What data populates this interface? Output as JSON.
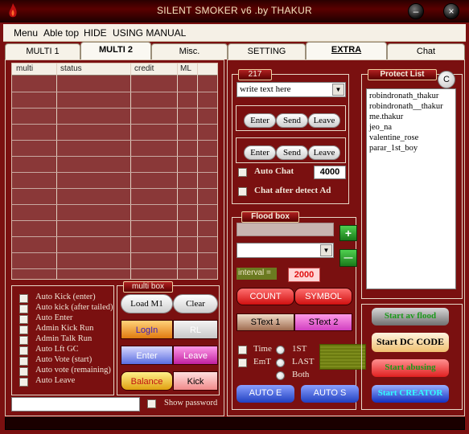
{
  "window": {
    "title": "SILENT SMOKER v6  .by THAKUR"
  },
  "menu": [
    "Menu",
    "Able top",
    "HIDE",
    "USING MANUAL"
  ],
  "tabs": [
    "MULTI 1",
    "MULTI 2",
    "Misc.",
    "SETTING",
    "EXTRA",
    "Chat"
  ],
  "grid": {
    "columns": [
      "multi",
      "status",
      "credit",
      "ML"
    ]
  },
  "multi_checks": [
    "Auto Kick (enter)",
    "Auto kick (after tailed)",
    "Auto Enter",
    "Admin Kick Run",
    "Admin Talk Run",
    "Auto Lft GC",
    "Auto Vote (start)",
    "Auto vote (remaining)",
    "Auto Leave"
  ],
  "multibox": {
    "legend": "multi box",
    "load": "Load M1",
    "clear": "Clear",
    "login": "LogIn",
    "rl": "RL",
    "enter": "Enter",
    "leave": "Leave",
    "balance": "Balance",
    "kick": "Kick"
  },
  "show_password": "Show password",
  "room": {
    "legend": "217",
    "text_select": "write text here",
    "row1": [
      "Enter",
      "Send",
      "Leave"
    ],
    "row2": [
      "Enter",
      "Send",
      "Leave"
    ],
    "auto_chat": "Auto Chat",
    "auto_chat_value": "4000",
    "chat_after": "Chat after detect Ad"
  },
  "flood": {
    "legend": "Flood box",
    "plus": "+",
    "minus": "—",
    "interval_label": "interval =",
    "interval_value": "2000",
    "count": "COUNT",
    "symbol": "SYMBOL",
    "stext1": "SText 1",
    "stext2": "SText 2",
    "time": "Time",
    "emt": "EmT",
    "r1st": "1ST",
    "last": "LAST",
    "both": "Both",
    "auto_e": "AUTO E",
    "auto_s": "AUTO S"
  },
  "protect": {
    "legend": "Protect List",
    "c": "C",
    "names": [
      "robindronath_thakur",
      "robindronath__thakur",
      "me.thakur",
      "jeo_na",
      "valentine_rose",
      "parar_1st_boy"
    ]
  },
  "actions": {
    "start_flood": "Start av flood",
    "start_dc": "Start DC CODE",
    "start_abusing": "Start abusing",
    "start_creator": "Start CREATOR"
  },
  "colors": {
    "window_bg": "#7a1010",
    "accent_green": "#2aa02a"
  }
}
